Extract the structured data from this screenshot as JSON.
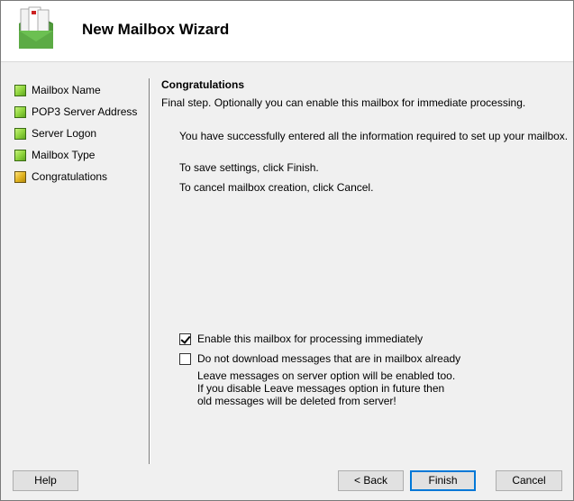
{
  "header": {
    "title": "New Mailbox Wizard"
  },
  "steps": [
    {
      "label": "Mailbox Name",
      "state": "done"
    },
    {
      "label": "POP3 Server Address",
      "state": "done"
    },
    {
      "label": "Server Logon",
      "state": "done"
    },
    {
      "label": "Mailbox Type",
      "state": "done"
    },
    {
      "label": "Congratulations",
      "state": "current"
    }
  ],
  "content": {
    "title": "Congratulations",
    "subtitle": "Final step. Optionally you can enable this mailbox for immediate processing.",
    "success_text": "You have successfully entered all the information required to set up your mailbox.",
    "save_text": "To save settings, click Finish.",
    "cancel_text": "To cancel mailbox creation, click Cancel."
  },
  "options": {
    "enable_label": "Enable this mailbox for processing immediately",
    "enable_checked": true,
    "no_download_label": "Do not download messages that are in mailbox already",
    "no_download_checked": false,
    "note_lines": [
      "Leave messages on server option will be enabled too.",
      "If you disable Leave messages option in future then",
      "old messages will be deleted from server!"
    ]
  },
  "buttons": {
    "help": "Help",
    "back": "< Back",
    "finish": "Finish",
    "cancel": "Cancel"
  },
  "colors": {
    "step_done": "#8cd23a",
    "step_current": "#e0b21e",
    "default_button_border": "#0078d7"
  }
}
